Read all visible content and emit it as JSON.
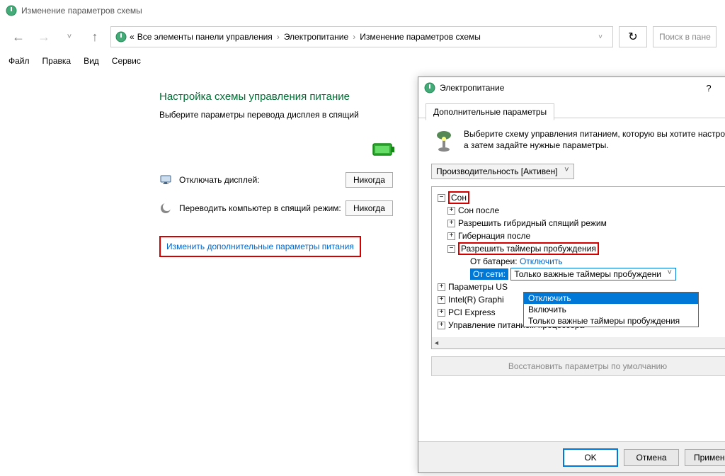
{
  "window": {
    "title": "Изменение параметров схемы"
  },
  "breadcrumb": {
    "prefix": "«",
    "items": [
      "Все элементы панели управления",
      "Электропитание",
      "Изменение параметров схемы"
    ]
  },
  "search": {
    "placeholder": "Поиск в пане"
  },
  "menu": [
    "Файл",
    "Правка",
    "Вид",
    "Сервис"
  ],
  "main": {
    "heading": "Настройка схемы управления питание",
    "subtext": "Выберите параметры перевода дисплея в спящий",
    "row1_label": "Отключать дисплей:",
    "row1_value": "Никогда",
    "row2_label": "Переводить компьютер в спящий режим:",
    "row2_value": "Никогда",
    "link": "Изменить дополнительные параметры питания"
  },
  "dialog": {
    "title": "Электропитание",
    "help": "?",
    "close": "✕",
    "tab": "Дополнительные параметры",
    "desc": "Выберите схему управления питанием, которую вы хотите настроить, а затем задайте нужные параметры.",
    "plan": "Производительность [Активен]",
    "tree": {
      "sleep": "Сон",
      "sleep_after": "Сон после",
      "hybrid": "Разрешить гибридный спящий режим",
      "hibernate": "Гибернация после",
      "wake_timers": "Разрешить таймеры пробуждения",
      "battery_label": "От батареи:",
      "battery_value": "Отключить",
      "ac_label": "От сети:",
      "ac_value": "Только важные таймеры пробуждени",
      "usb": "Параметры US",
      "intel": "Intel(R) Graphi",
      "pci": "PCI Express",
      "cpu": "Управление питанием процессора"
    },
    "dropdown": {
      "opt1": "Отключить",
      "opt2": "Включить",
      "opt3": "Только важные таймеры пробуждения"
    },
    "restore": "Восстановить параметры по умолчанию",
    "ok": "OK",
    "cancel": "Отмена",
    "apply": "Применить"
  }
}
